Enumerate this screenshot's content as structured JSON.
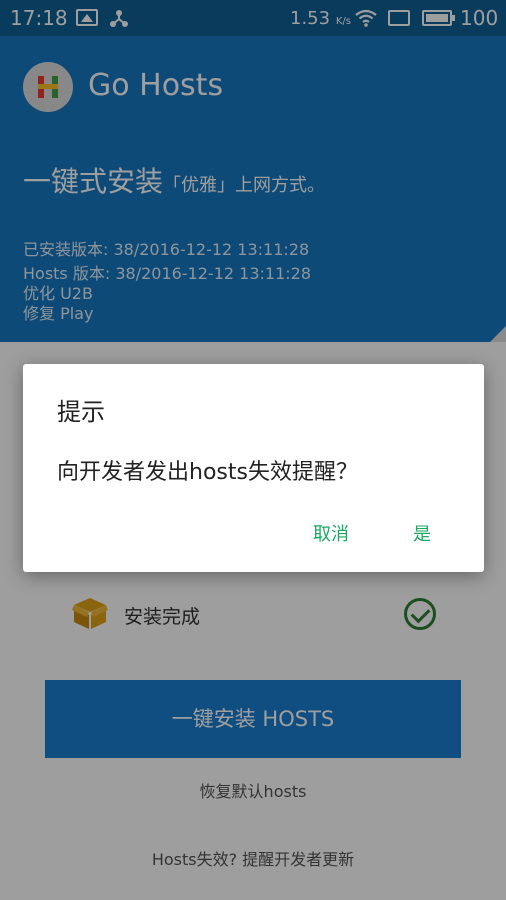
{
  "status_bar": {
    "time": "17:18",
    "speed": "1.53",
    "speed_unit": "K/s",
    "battery": "100"
  },
  "header": {
    "app_title": "Go Hosts",
    "tagline_main": "一键式安装",
    "tagline_sub": "「优雅」上网方式。",
    "installed_version": "已安装版本: 38/2016-12-12 13:11:28",
    "hosts_version": "Hosts 版本: 38/2016-12-12 13:11:28",
    "optimize": "优化  U2B",
    "fix": "修复  Play"
  },
  "main": {
    "install_done": "安装完成",
    "install_button": "一键安装 HOSTS",
    "restore_link": "恢复默认hosts",
    "remind_link": "Hosts失效? 提醒开发者更新"
  },
  "dialog": {
    "title": "提示",
    "message": "向开发者发出hosts失效提醒？",
    "cancel": "取消",
    "confirm": "是"
  },
  "colors": {
    "primary": "#1678c2",
    "accent": "#1aa863",
    "success": "#2e7d32",
    "box": "#e0a21b"
  }
}
